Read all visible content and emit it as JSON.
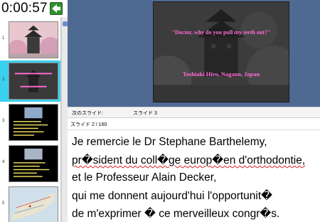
{
  "presenter": {
    "timer": "0:00:57",
    "back_icon": "green-left-arrow-icon"
  },
  "thumbnails": [
    {
      "number": "1",
      "kind": "castle-photo"
    },
    {
      "number": "2",
      "kind": "castle-dark",
      "quote": "\"Doctor, why do you pull my teeth out?\"",
      "credit": "Toshiaki Hiro, Nagano, Japan"
    },
    {
      "number": "3",
      "kind": "text-slide-photo"
    },
    {
      "number": "4",
      "kind": "text-slide-photo"
    },
    {
      "number": "5",
      "kind": "map"
    }
  ],
  "slide": {
    "quote": "\"Doctor, why do you pull my teeth out?\"",
    "credit": "Toshiaki Hiro, Nagano, Japan"
  },
  "next_slide": {
    "label": "次のスライド:",
    "value": "スライド 3"
  },
  "counter": "スライド 2 / 160",
  "notes": {
    "line1": "Je remercie le Dr Stephane Barthelemy,",
    "line2": "pr�sident du coll�ge europ�en d'orthodontie,",
    "line3": "et le Professeur Alain Decker,",
    "line4": "qui me donnent aujourd'hui l'opportunit�",
    "line5": "de m'exprimer � ce merveilleux congr�s."
  },
  "colors": {
    "stage": "#4f6a92",
    "selected_thumb": "#3cd0f0",
    "slide_text": "#ff6ad5",
    "back_button": "#2f8f2f"
  }
}
